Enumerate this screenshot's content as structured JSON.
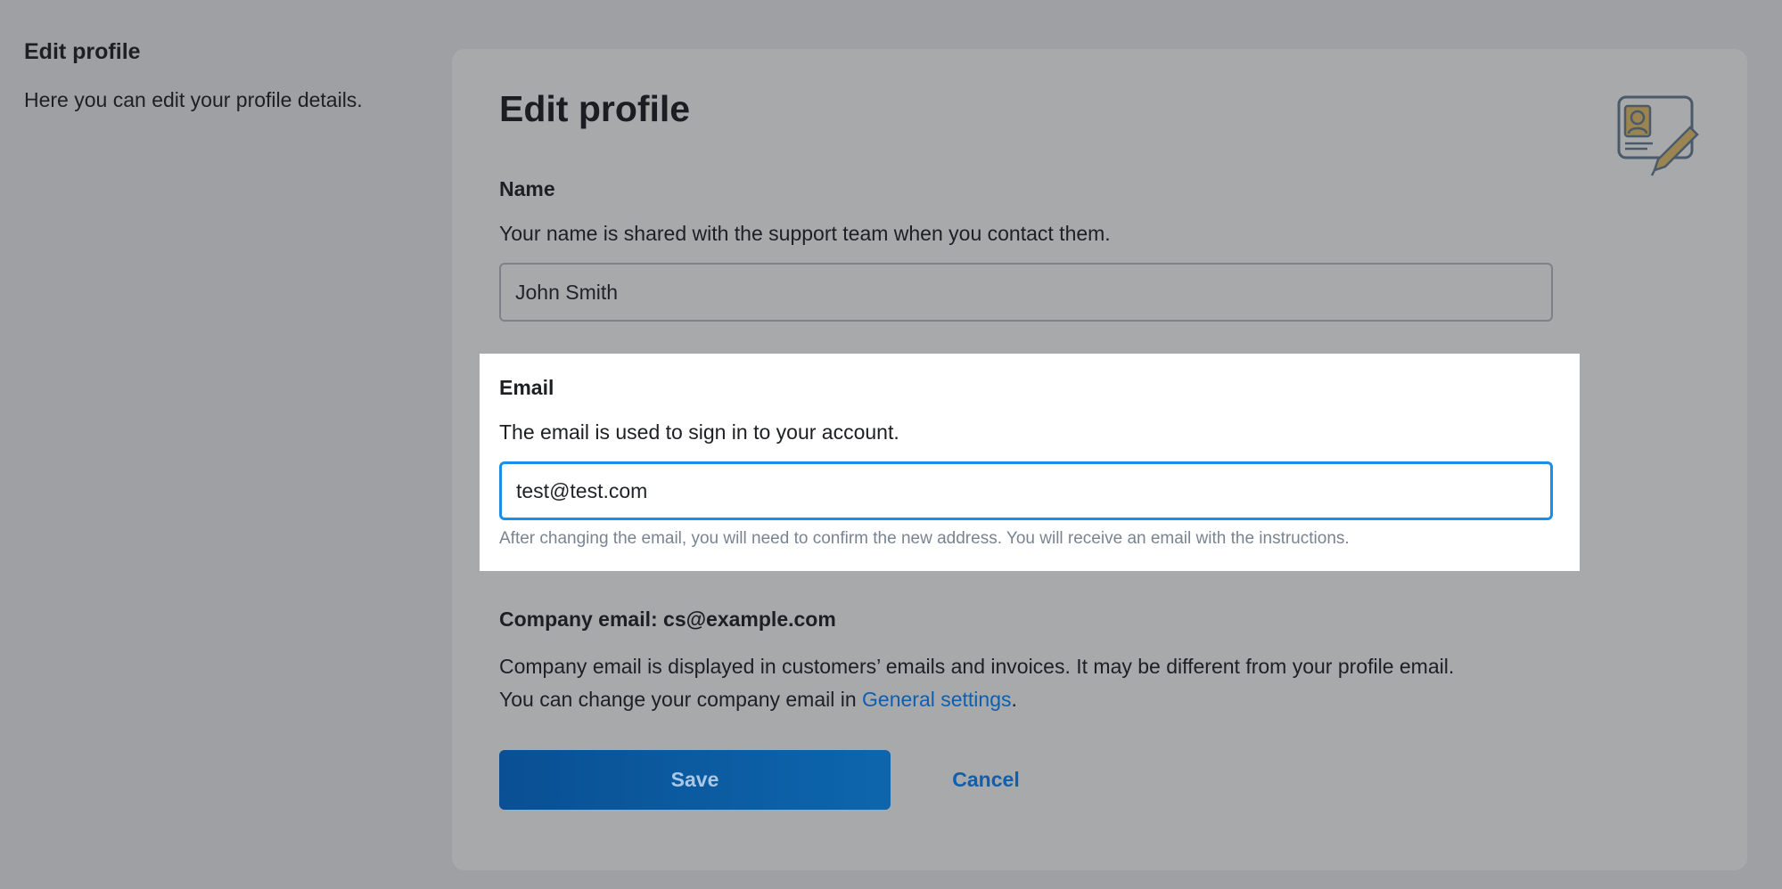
{
  "intro": {
    "title": "Edit profile",
    "description": "Here you can edit your profile details."
  },
  "card": {
    "title": "Edit profile",
    "icon": "profile-card-edit-icon"
  },
  "name": {
    "label": "Name",
    "help": "Your name is shared with the support team when you contact them.",
    "value": "John Smith"
  },
  "email": {
    "label": "Email",
    "help": "The email is used to sign in to your account.",
    "value": "test@test.com",
    "note": "After changing the email, you will need to confirm the new address. You will receive an email with the instructions."
  },
  "company": {
    "label": "Company email: cs@example.com",
    "desc_line1": "Company email is displayed in customers’ emails and invoices. It may be different from your profile email.",
    "desc_line2_prefix": "You can change your company email in ",
    "link_text": "General settings",
    "desc_line2_suffix": "."
  },
  "actions": {
    "save_label": "Save",
    "cancel_label": "Cancel"
  },
  "colors": {
    "overlay_background": "#9ea0a3",
    "card_background": "#a8a9ab",
    "accent": "#1a8ee8",
    "link": "#0d5fb0",
    "button_start": "#0a4f93",
    "button_end": "#0d66ad"
  }
}
